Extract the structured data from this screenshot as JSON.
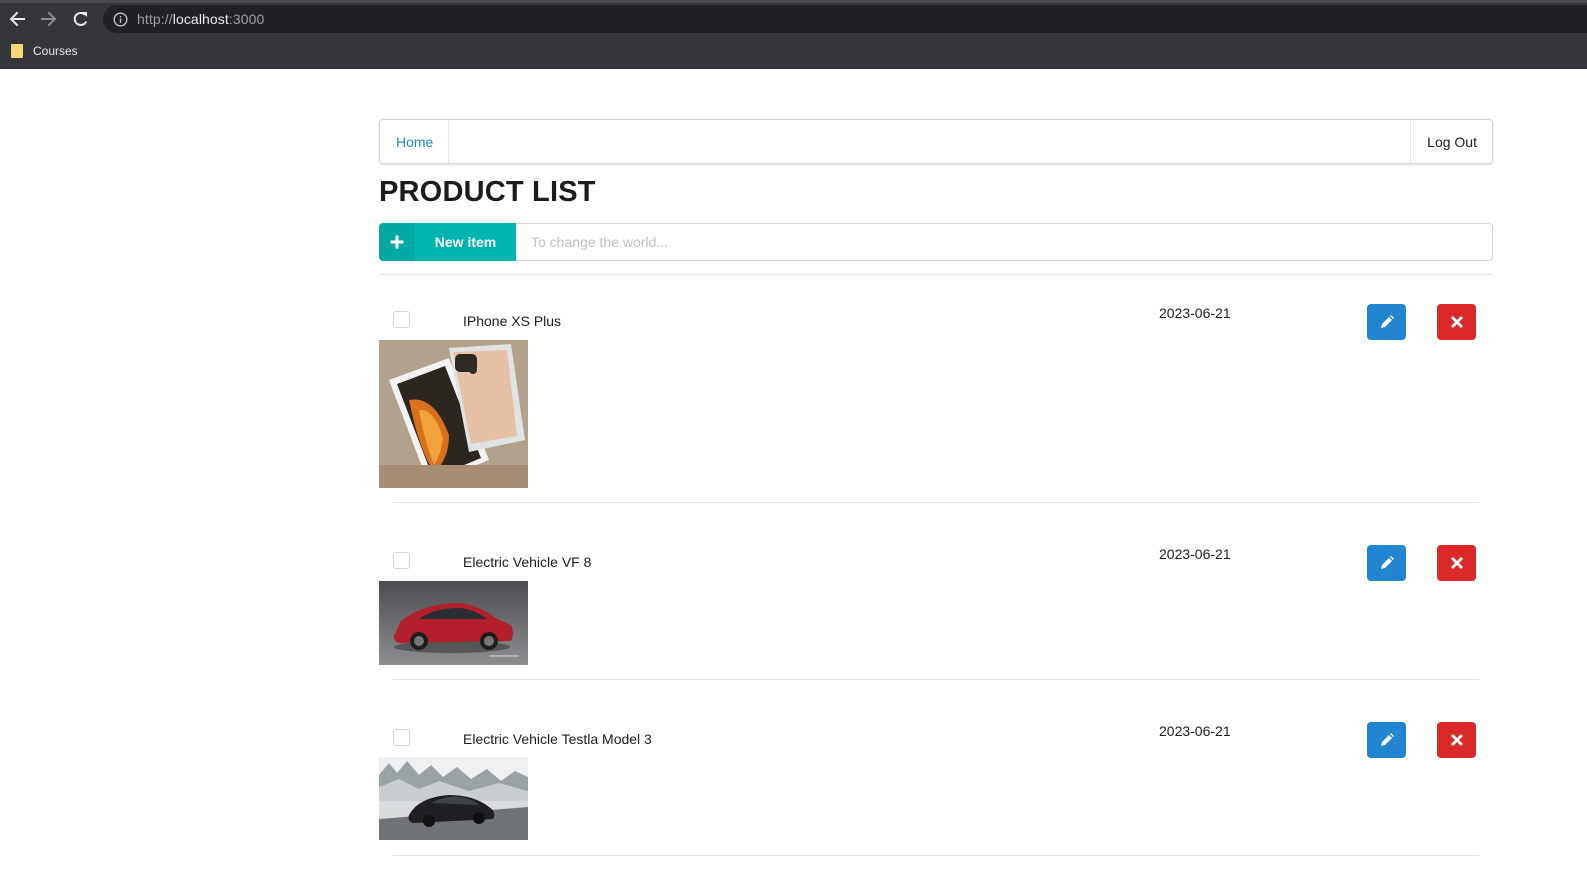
{
  "browser": {
    "url_scheme": "http://",
    "url_host": "localhost",
    "url_port": ":3000",
    "bookmarks": [
      {
        "label": "Courses",
        "icon": "folder-icon"
      }
    ]
  },
  "menu": {
    "home_label": "Home",
    "logout_label": "Log Out"
  },
  "page": {
    "title": "PRODUCT LIST",
    "new_item_label": "New item",
    "new_item_icon": "plus-icon",
    "input_placeholder": "To change the world..."
  },
  "colors": {
    "accent_teal": "#00b5ad",
    "edit_blue": "#2185d0",
    "delete_red": "#db2828",
    "link_blue": "#2185d0"
  },
  "items": [
    {
      "name": "IPhone XS Plus",
      "date": "2023-06-21",
      "checked": false,
      "image": "iphone-xs-photo"
    },
    {
      "name": "Electric Vehicle VF 8",
      "date": "2023-06-21",
      "checked": false,
      "image": "red-suv-photo"
    },
    {
      "name": "Electric Vehicle Testla Model 3",
      "date": "2023-06-21",
      "checked": false,
      "image": "black-sedan-snow-photo"
    }
  ]
}
